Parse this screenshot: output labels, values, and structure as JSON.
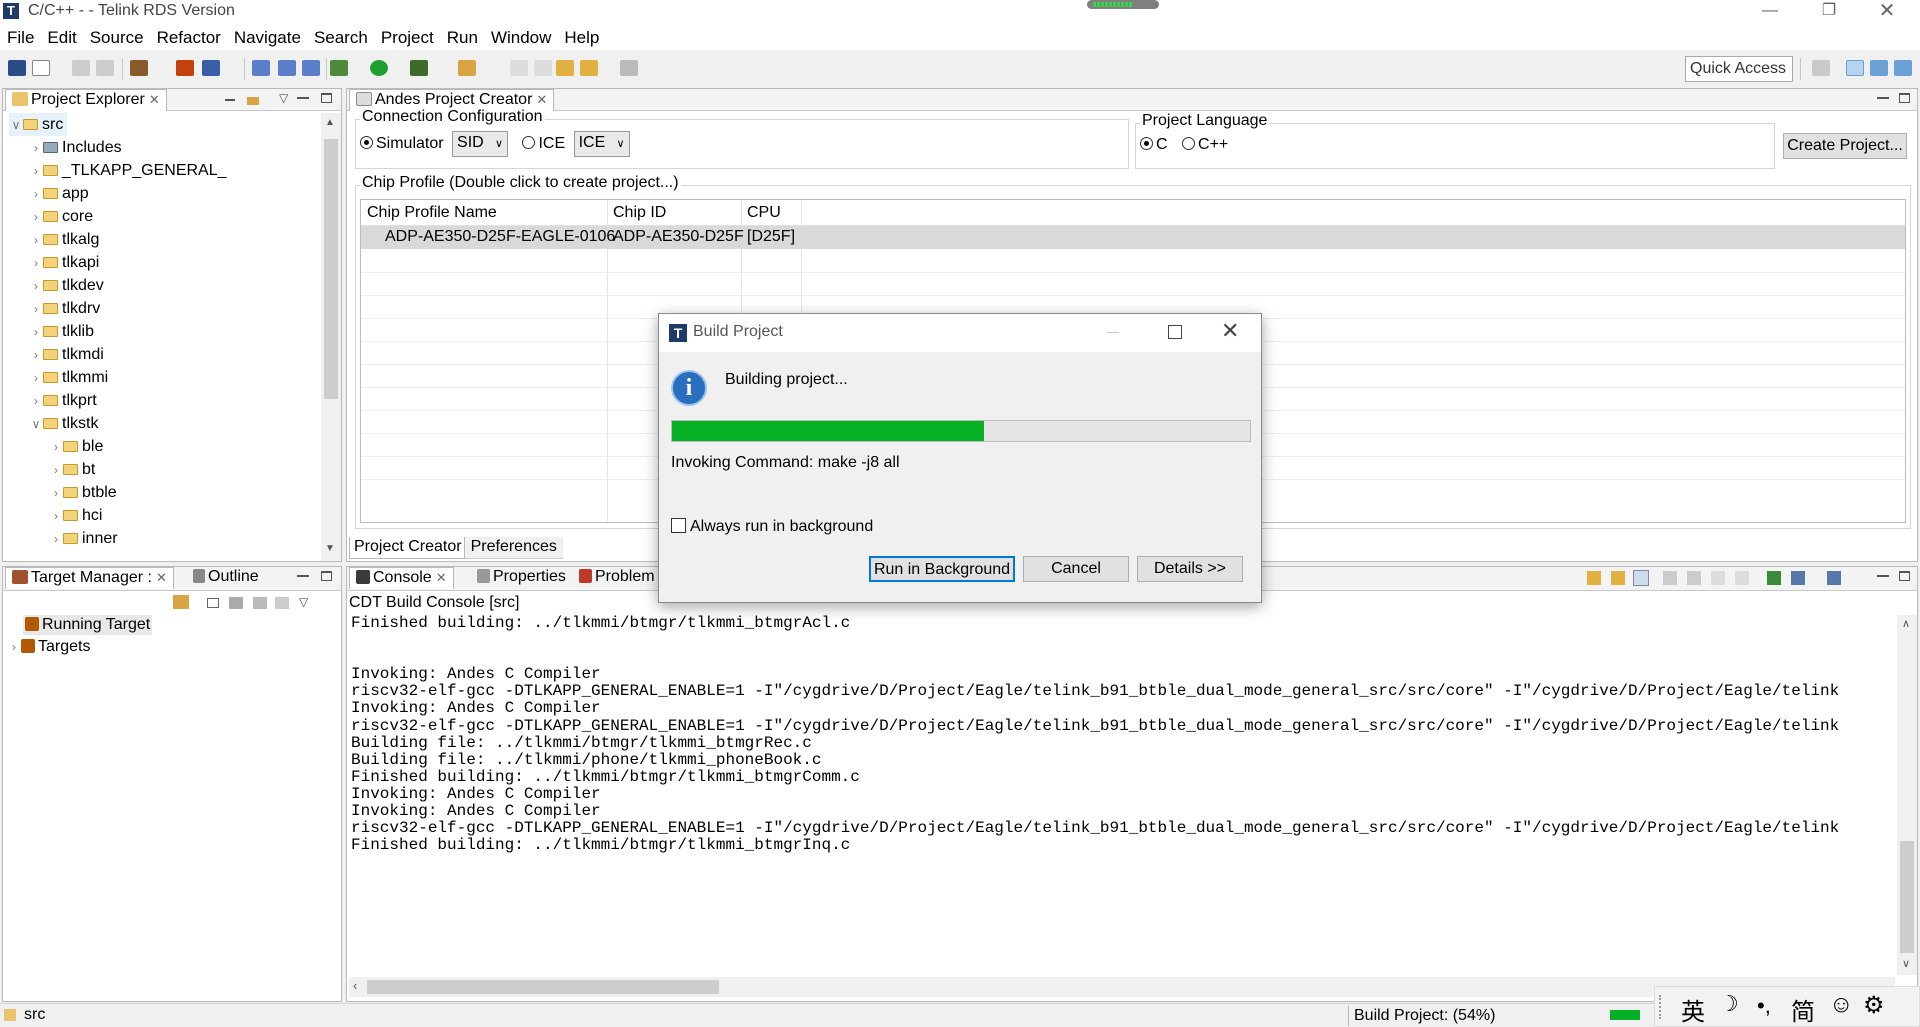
{
  "window": {
    "title": "C/C++ -  - Telink RDS Version",
    "app_logo": "T"
  },
  "menu": [
    "File",
    "Edit",
    "Source",
    "Refactor",
    "Navigate",
    "Search",
    "Project",
    "Run",
    "Window",
    "Help"
  ],
  "toolbar": {
    "quick_access": "Quick Access"
  },
  "project_explorer": {
    "tab": "Project Explorer",
    "root": "src",
    "items": [
      {
        "label": "Includes",
        "indent": 1,
        "expanded": false
      },
      {
        "label": "_TLKAPP_GENERAL_",
        "indent": 1,
        "expanded": false
      },
      {
        "label": "app",
        "indent": 1,
        "expanded": false
      },
      {
        "label": "core",
        "indent": 1,
        "expanded": false
      },
      {
        "label": "tlkalg",
        "indent": 1,
        "expanded": false
      },
      {
        "label": "tlkapi",
        "indent": 1,
        "expanded": false
      },
      {
        "label": "tlkdev",
        "indent": 1,
        "expanded": false
      },
      {
        "label": "tlkdrv",
        "indent": 1,
        "expanded": false
      },
      {
        "label": "tlklib",
        "indent": 1,
        "expanded": false
      },
      {
        "label": "tlkmdi",
        "indent": 1,
        "expanded": false
      },
      {
        "label": "tlkmmi",
        "indent": 1,
        "expanded": false
      },
      {
        "label": "tlkprt",
        "indent": 1,
        "expanded": false
      },
      {
        "label": "tlkstk",
        "indent": 1,
        "expanded": true
      },
      {
        "label": "ble",
        "indent": 2,
        "expanded": false
      },
      {
        "label": "bt",
        "indent": 2,
        "expanded": false
      },
      {
        "label": "btble",
        "indent": 2,
        "expanded": false
      },
      {
        "label": "hci",
        "indent": 2,
        "expanded": false
      },
      {
        "label": "inner",
        "indent": 2,
        "expanded": false
      }
    ]
  },
  "creator": {
    "tab": "Andes Project Creator",
    "connection": {
      "title": "Connection Configuration",
      "simulator": "Simulator",
      "simulator_value": "SID",
      "ice": "ICE",
      "ice_value": "ICE"
    },
    "language": {
      "title": "Project Language",
      "c": "C",
      "cpp": "C++"
    },
    "create_button": "Create Project...",
    "chip_profile": {
      "title": "Chip Profile (Double click to create project...)",
      "columns": [
        "Chip Profile Name",
        "Chip ID",
        "CPU"
      ],
      "rows": [
        [
          "ADP-AE350-D25F-EAGLE-0106",
          "ADP-AE350-D25F",
          "[D25F]"
        ]
      ]
    },
    "bottom_tabs": [
      "Project Creator",
      "Preferences"
    ]
  },
  "target_manager": {
    "tabs": [
      "Target Manager :",
      "Outline"
    ],
    "items": [
      "Running Target",
      "Targets"
    ]
  },
  "console": {
    "tabs": [
      "Console",
      "Properties",
      "Problem"
    ],
    "header": "CDT Build Console [src]",
    "lines": [
      "Finished building: ../tlkmmi/btmgr/tlkmmi_btmgrAcl.c",
      "",
      "",
      "Invoking: Andes C Compiler",
      "riscv32-elf-gcc -DTLKAPP_GENERAL_ENABLE=1 -I\"/cygdrive/D/Project/Eagle/telink_b91_btble_dual_mode_general_src/src/core\" -I\"/cygdrive/D/Project/Eagle/telink",
      "Invoking: Andes C Compiler",
      "riscv32-elf-gcc -DTLKAPP_GENERAL_ENABLE=1 -I\"/cygdrive/D/Project/Eagle/telink_b91_btble_dual_mode_general_src/src/core\" -I\"/cygdrive/D/Project/Eagle/telink",
      "Building file: ../tlkmmi/btmgr/tlkmmi_btmgrRec.c",
      "Building file: ../tlkmmi/phone/tlkmmi_phoneBook.c",
      "Finished building: ../tlkmmi/btmgr/tlkmmi_btmgrComm.c",
      "Invoking: Andes C Compiler",
      "Invoking: Andes C Compiler",
      "riscv32-elf-gcc -DTLKAPP_GENERAL_ENABLE=1 -I\"/cygdrive/D/Project/Eagle/telink_b91_btble_dual_mode_general_src/src/core\" -I\"/cygdrive/D/Project/Eagle/telink",
      "Finished building: ../tlkmmi/btmgr/tlkmmi_btmgrInq.c"
    ]
  },
  "dialog": {
    "title": "Build Project",
    "message": "Building project...",
    "progress": 0.54,
    "command": "Invoking Command: make -j8 all",
    "checkbox": "Always run in background",
    "buttons": {
      "background": "Run in Background",
      "cancel": "Cancel",
      "details": "Details >>"
    }
  },
  "status": {
    "left": "src",
    "build": "Build Project: (54%)",
    "ime": [
      "英",
      "简"
    ]
  },
  "colors": {
    "progress": "#06b025",
    "selection": "#d9d9d9",
    "accent": "#0078d7"
  }
}
